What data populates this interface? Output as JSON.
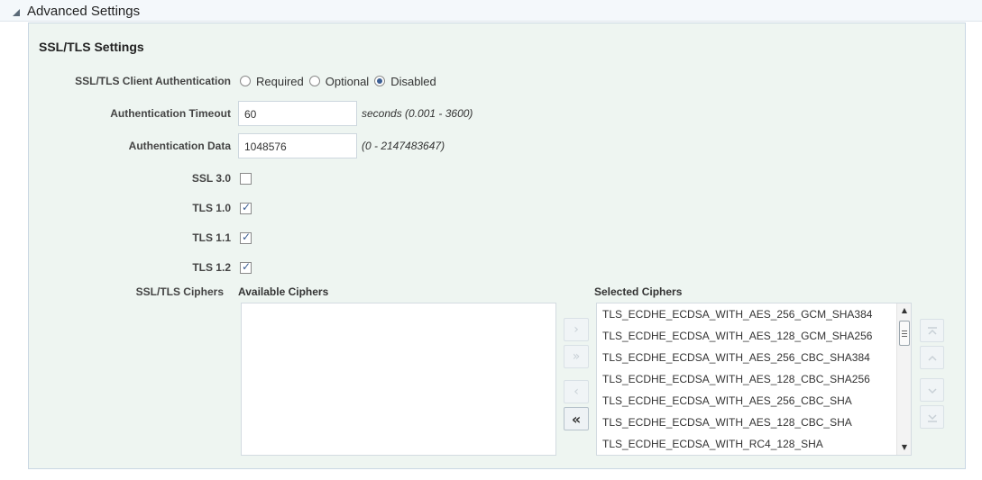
{
  "section": {
    "title": "Advanced Settings"
  },
  "panel": {
    "title": "SSL/TLS Settings"
  },
  "client_auth": {
    "label": "SSL/TLS Client Authentication",
    "options": [
      "Required",
      "Optional",
      "Disabled"
    ],
    "selected": "Disabled"
  },
  "auth_timeout": {
    "label": "Authentication Timeout",
    "value": "60",
    "hint": "seconds (0.001 - 3600)"
  },
  "auth_data": {
    "label": "Authentication Data",
    "value": "1048576",
    "hint": "(0 - 2147483647)"
  },
  "protocols": [
    {
      "label": "SSL 3.0",
      "checked": false
    },
    {
      "label": "TLS 1.0",
      "checked": true
    },
    {
      "label": "TLS 1.1",
      "checked": true
    },
    {
      "label": "TLS 1.2",
      "checked": true
    }
  ],
  "ciphers": {
    "label": "SSL/TLS Ciphers",
    "available_title": "Available Ciphers",
    "selected_title": "Selected Ciphers",
    "selected": [
      "TLS_ECDHE_ECDSA_WITH_AES_256_GCM_SHA384",
      "TLS_ECDHE_ECDSA_WITH_AES_128_GCM_SHA256",
      "TLS_ECDHE_ECDSA_WITH_AES_256_CBC_SHA384",
      "TLS_ECDHE_ECDSA_WITH_AES_128_CBC_SHA256",
      "TLS_ECDHE_ECDSA_WITH_AES_256_CBC_SHA",
      "TLS_ECDHE_ECDSA_WITH_AES_128_CBC_SHA",
      "TLS_ECDHE_ECDSA_WITH_RC4_128_SHA"
    ]
  },
  "shuttle": {
    "move": "›",
    "move_all": "»",
    "remove": "‹",
    "remove_all": "«"
  }
}
